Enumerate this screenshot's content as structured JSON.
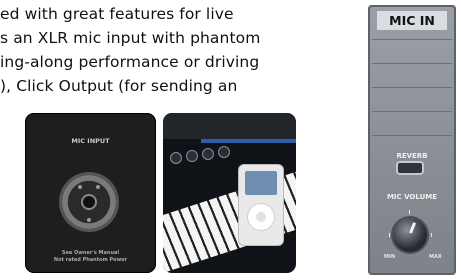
{
  "text": {
    "lines": [
      "ed with great features for live",
      "s an XLR mic input with phantom",
      "ing-along performance or driving",
      "), Click Output (for sending an"
    ]
  },
  "photo_mic_input": {
    "heading": "MIC INPUT",
    "caption_line_1": "See Owner's Manual",
    "caption_line_2": "Not rated Phantom Power"
  },
  "panel": {
    "title": "MIC IN",
    "reverb_label": "REVERB",
    "volume_label": "MIC VOLUME",
    "min_label": "MIN",
    "max_label": "MAX"
  }
}
